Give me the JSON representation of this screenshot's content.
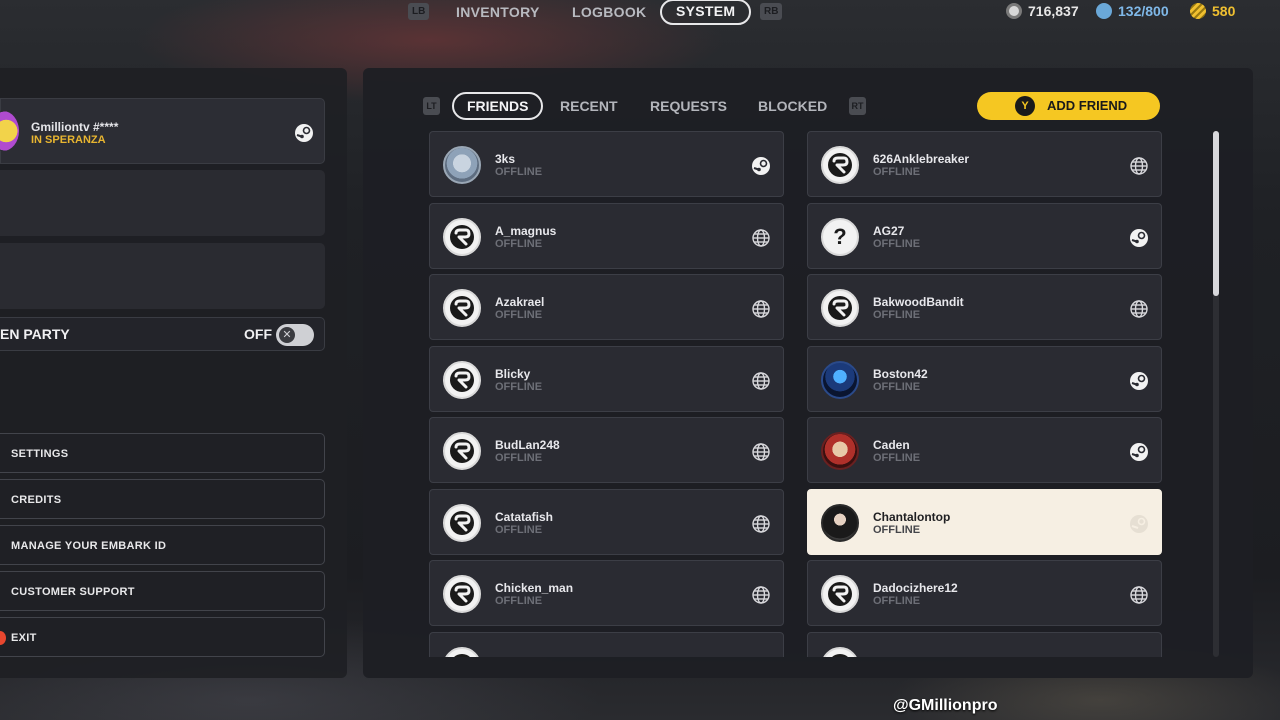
{
  "top_nav": {
    "left_trigger": "LB",
    "right_trigger": "RB",
    "tabs": [
      {
        "label": "INVENTORY",
        "active": false
      },
      {
        "label": "LOGBOOK",
        "active": false
      },
      {
        "label": "SYSTEM",
        "active": true
      }
    ],
    "currencies": [
      {
        "icon": "coin-icon",
        "value": "716,837",
        "color": "#e6e6e6"
      },
      {
        "icon": "embark-token-icon",
        "value": "132/800",
        "color": "#7fb8e8"
      },
      {
        "icon": "tickets-icon",
        "value": "580",
        "color": "#f0c030"
      }
    ]
  },
  "left_panel": {
    "profile": {
      "name": "Gmilliontv #****",
      "status": "IN SPERANZA",
      "platform_icon": "steam-icon"
    },
    "party": {
      "label": "EN PARTY",
      "toggle_label": "OFF",
      "toggle_on": false
    },
    "menu": [
      {
        "label": "SETTINGS"
      },
      {
        "label": "CREDITS"
      },
      {
        "label": "MANAGE YOUR EMBARK ID"
      },
      {
        "label": "CUSTOMER SUPPORT"
      },
      {
        "label": "EXIT"
      }
    ]
  },
  "friends_panel": {
    "left_trigger": "LT",
    "right_trigger": "RT",
    "tabs": [
      {
        "label": "FRIENDS",
        "active": true
      },
      {
        "label": "RECENT",
        "active": false
      },
      {
        "label": "REQUESTS",
        "active": false
      },
      {
        "label": "BLOCKED",
        "active": false
      }
    ],
    "add_button": {
      "key": "Y",
      "label": "ADD FRIEND"
    },
    "scroll_position": 0.0,
    "friends_left": [
      {
        "name": "3ks",
        "status": "OFFLINE",
        "avatar": "photo-1",
        "platform": "steam-icon"
      },
      {
        "name": "A_magnus",
        "status": "OFFLINE",
        "avatar": "embark-logo",
        "platform": "globe-icon"
      },
      {
        "name": "Azakrael",
        "status": "OFFLINE",
        "avatar": "embark-logo",
        "platform": "globe-icon"
      },
      {
        "name": "Blicky",
        "status": "OFFLINE",
        "avatar": "embark-logo",
        "platform": "globe-icon"
      },
      {
        "name": "BudLan248",
        "status": "OFFLINE",
        "avatar": "embark-logo",
        "platform": "globe-icon"
      },
      {
        "name": "Catatafish",
        "status": "OFFLINE",
        "avatar": "embark-logo",
        "platform": "globe-icon"
      },
      {
        "name": "Chicken_man",
        "status": "OFFLINE",
        "avatar": "embark-logo",
        "platform": "globe-icon"
      },
      {
        "name": "",
        "status": "",
        "avatar": "embark-logo",
        "platform": "globe-icon"
      }
    ],
    "friends_right": [
      {
        "name": "626Anklebreaker",
        "status": "OFFLINE",
        "avatar": "embark-logo",
        "platform": "globe-icon"
      },
      {
        "name": "AG27",
        "status": "OFFLINE",
        "avatar": "question",
        "platform": "steam-icon"
      },
      {
        "name": "BakwoodBandit",
        "status": "OFFLINE",
        "avatar": "embark-logo",
        "platform": "globe-icon"
      },
      {
        "name": "Boston42",
        "status": "OFFLINE",
        "avatar": "photo-2",
        "platform": "steam-icon"
      },
      {
        "name": "Caden",
        "status": "OFFLINE",
        "avatar": "photo-3",
        "platform": "steam-icon"
      },
      {
        "name": "Chantalontop",
        "status": "OFFLINE",
        "avatar": "photo-4",
        "platform": "steam-icon",
        "highlighted": true
      },
      {
        "name": "Dadocizhere12",
        "status": "OFFLINE",
        "avatar": "embark-logo",
        "platform": "globe-icon"
      },
      {
        "name": "",
        "status": "",
        "avatar": "embark-logo",
        "platform": "globe-icon"
      }
    ]
  },
  "watermark": "@GMillionpro"
}
